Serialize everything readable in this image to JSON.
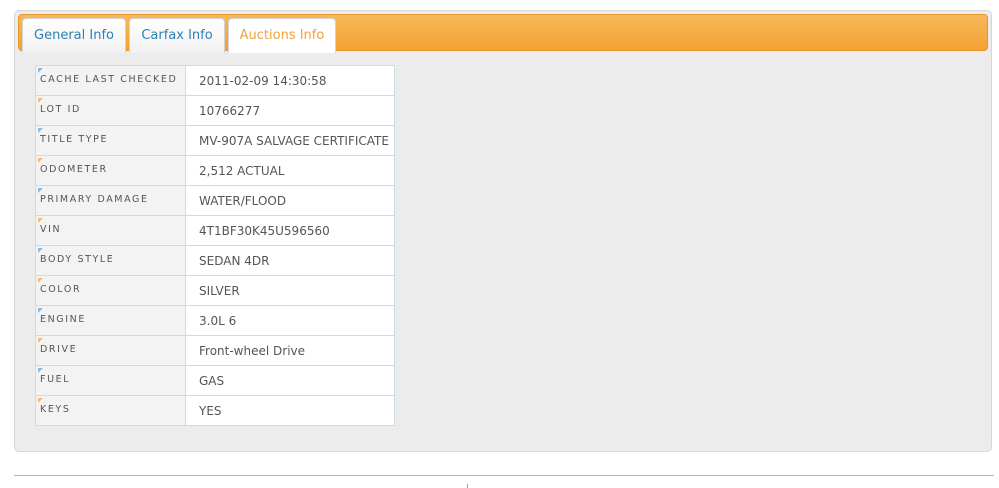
{
  "tabs": [
    {
      "label": "General Info"
    },
    {
      "label": "Carfax Info"
    },
    {
      "label": "Auctions Info"
    }
  ],
  "active_tab": "Auctions Info",
  "rows": [
    {
      "label": "CACHE LAST CHECKED",
      "value": "2011-02-09 14:30:58"
    },
    {
      "label": "LOT ID",
      "value": "10766277"
    },
    {
      "label": "TITLE TYPE",
      "value": "MV-907A SALVAGE CERTIFICATE"
    },
    {
      "label": "ODOMETER",
      "value": "2,512 ACTUAL"
    },
    {
      "label": "PRIMARY DAMAGE",
      "value": "WATER/FLOOD"
    },
    {
      "label": "VIN",
      "value": "4T1BF30K45U596560"
    },
    {
      "label": "BODY STYLE",
      "value": "SEDAN 4DR"
    },
    {
      "label": "COLOR",
      "value": "SILVER"
    },
    {
      "label": "ENGINE",
      "value": "3.0L 6"
    },
    {
      "label": "DRIVE",
      "value": "Front-wheel Drive"
    },
    {
      "label": "FUEL",
      "value": "GAS"
    },
    {
      "label": "KEYS",
      "value": "YES"
    }
  ],
  "colors": {
    "tabbar": "#f3a132",
    "tab_text": "#2d80b3",
    "active_tab_text": "#f0a23c"
  }
}
